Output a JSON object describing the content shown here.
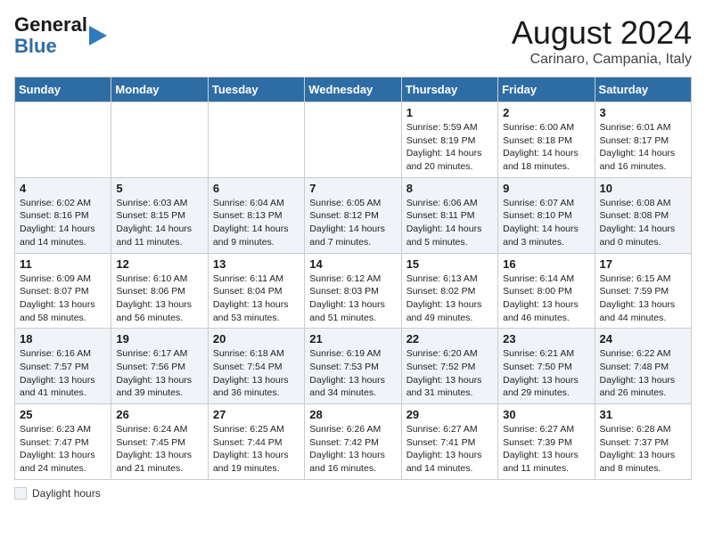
{
  "header": {
    "logo_line1": "General",
    "logo_line2": "Blue",
    "title": "August 2024",
    "subtitle": "Carinaro, Campania, Italy"
  },
  "columns": [
    "Sunday",
    "Monday",
    "Tuesday",
    "Wednesday",
    "Thursday",
    "Friday",
    "Saturday"
  ],
  "weeks": [
    [
      {
        "num": "",
        "info": ""
      },
      {
        "num": "",
        "info": ""
      },
      {
        "num": "",
        "info": ""
      },
      {
        "num": "",
        "info": ""
      },
      {
        "num": "1",
        "info": "Sunrise: 5:59 AM\nSunset: 8:19 PM\nDaylight: 14 hours and 20 minutes."
      },
      {
        "num": "2",
        "info": "Sunrise: 6:00 AM\nSunset: 8:18 PM\nDaylight: 14 hours and 18 minutes."
      },
      {
        "num": "3",
        "info": "Sunrise: 6:01 AM\nSunset: 8:17 PM\nDaylight: 14 hours and 16 minutes."
      }
    ],
    [
      {
        "num": "4",
        "info": "Sunrise: 6:02 AM\nSunset: 8:16 PM\nDaylight: 14 hours and 14 minutes."
      },
      {
        "num": "5",
        "info": "Sunrise: 6:03 AM\nSunset: 8:15 PM\nDaylight: 14 hours and 11 minutes."
      },
      {
        "num": "6",
        "info": "Sunrise: 6:04 AM\nSunset: 8:13 PM\nDaylight: 14 hours and 9 minutes."
      },
      {
        "num": "7",
        "info": "Sunrise: 6:05 AM\nSunset: 8:12 PM\nDaylight: 14 hours and 7 minutes."
      },
      {
        "num": "8",
        "info": "Sunrise: 6:06 AM\nSunset: 8:11 PM\nDaylight: 14 hours and 5 minutes."
      },
      {
        "num": "9",
        "info": "Sunrise: 6:07 AM\nSunset: 8:10 PM\nDaylight: 14 hours and 3 minutes."
      },
      {
        "num": "10",
        "info": "Sunrise: 6:08 AM\nSunset: 8:08 PM\nDaylight: 14 hours and 0 minutes."
      }
    ],
    [
      {
        "num": "11",
        "info": "Sunrise: 6:09 AM\nSunset: 8:07 PM\nDaylight: 13 hours and 58 minutes."
      },
      {
        "num": "12",
        "info": "Sunrise: 6:10 AM\nSunset: 8:06 PM\nDaylight: 13 hours and 56 minutes."
      },
      {
        "num": "13",
        "info": "Sunrise: 6:11 AM\nSunset: 8:04 PM\nDaylight: 13 hours and 53 minutes."
      },
      {
        "num": "14",
        "info": "Sunrise: 6:12 AM\nSunset: 8:03 PM\nDaylight: 13 hours and 51 minutes."
      },
      {
        "num": "15",
        "info": "Sunrise: 6:13 AM\nSunset: 8:02 PM\nDaylight: 13 hours and 49 minutes."
      },
      {
        "num": "16",
        "info": "Sunrise: 6:14 AM\nSunset: 8:00 PM\nDaylight: 13 hours and 46 minutes."
      },
      {
        "num": "17",
        "info": "Sunrise: 6:15 AM\nSunset: 7:59 PM\nDaylight: 13 hours and 44 minutes."
      }
    ],
    [
      {
        "num": "18",
        "info": "Sunrise: 6:16 AM\nSunset: 7:57 PM\nDaylight: 13 hours and 41 minutes."
      },
      {
        "num": "19",
        "info": "Sunrise: 6:17 AM\nSunset: 7:56 PM\nDaylight: 13 hours and 39 minutes."
      },
      {
        "num": "20",
        "info": "Sunrise: 6:18 AM\nSunset: 7:54 PM\nDaylight: 13 hours and 36 minutes."
      },
      {
        "num": "21",
        "info": "Sunrise: 6:19 AM\nSunset: 7:53 PM\nDaylight: 13 hours and 34 minutes."
      },
      {
        "num": "22",
        "info": "Sunrise: 6:20 AM\nSunset: 7:52 PM\nDaylight: 13 hours and 31 minutes."
      },
      {
        "num": "23",
        "info": "Sunrise: 6:21 AM\nSunset: 7:50 PM\nDaylight: 13 hours and 29 minutes."
      },
      {
        "num": "24",
        "info": "Sunrise: 6:22 AM\nSunset: 7:48 PM\nDaylight: 13 hours and 26 minutes."
      }
    ],
    [
      {
        "num": "25",
        "info": "Sunrise: 6:23 AM\nSunset: 7:47 PM\nDaylight: 13 hours and 24 minutes."
      },
      {
        "num": "26",
        "info": "Sunrise: 6:24 AM\nSunset: 7:45 PM\nDaylight: 13 hours and 21 minutes."
      },
      {
        "num": "27",
        "info": "Sunrise: 6:25 AM\nSunset: 7:44 PM\nDaylight: 13 hours and 19 minutes."
      },
      {
        "num": "28",
        "info": "Sunrise: 6:26 AM\nSunset: 7:42 PM\nDaylight: 13 hours and 16 minutes."
      },
      {
        "num": "29",
        "info": "Sunrise: 6:27 AM\nSunset: 7:41 PM\nDaylight: 13 hours and 14 minutes."
      },
      {
        "num": "30",
        "info": "Sunrise: 6:27 AM\nSunset: 7:39 PM\nDaylight: 13 hours and 11 minutes."
      },
      {
        "num": "31",
        "info": "Sunrise: 6:28 AM\nSunset: 7:37 PM\nDaylight: 13 hours and 8 minutes."
      }
    ]
  ],
  "footer": {
    "daylight_label": "Daylight hours"
  }
}
